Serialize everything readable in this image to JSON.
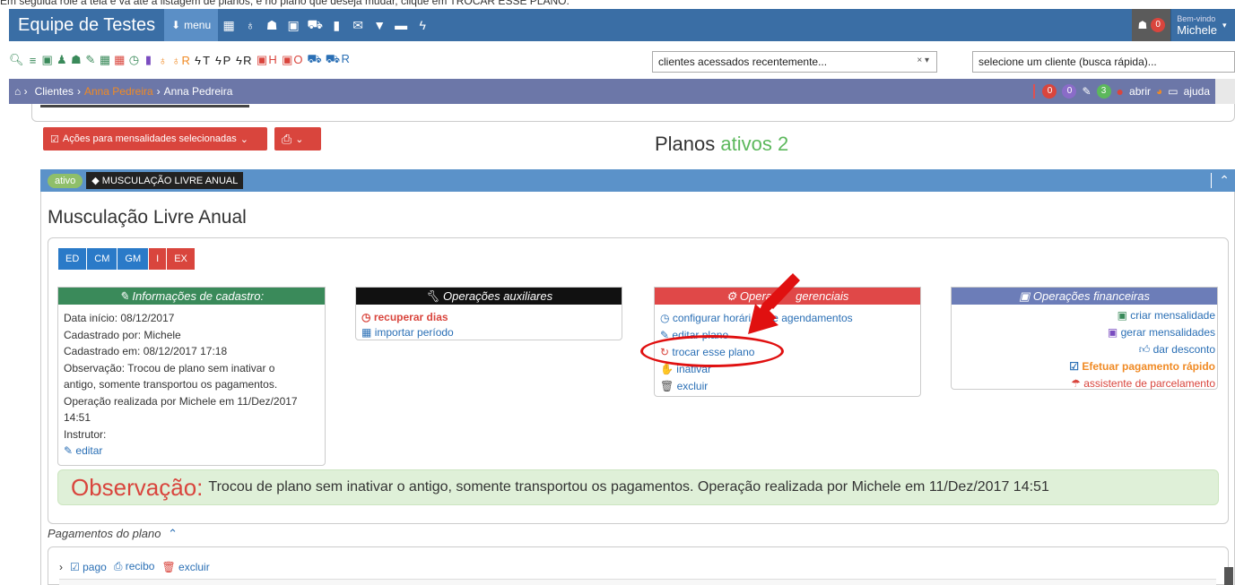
{
  "caption": "Em seguida role a tela e vá até a listagem de planos, e no plano que deseja mudar, clique em TROCAR ESSE PLANO.",
  "topbar": {
    "brand": "Equipe de Testes",
    "menu_label": "menu",
    "users_badge": "0",
    "welcome_small": "Bem-vindo",
    "welcome_name": "Michele"
  },
  "toolbar": {
    "icons_tail": [
      "R",
      "T",
      "P",
      "R",
      "H",
      "O",
      "R"
    ],
    "recent_clients": "clientes acessados recentemente...",
    "recent_clients_clear": "× ▾",
    "quick_search_placeholder": "selecione um cliente (busca rápida)..."
  },
  "breadcrumb": {
    "clientes": "Clientes",
    "link_name": "Anna Pedreira",
    "current": "Anna Pedreira",
    "badge1": "0",
    "badge2": "0",
    "badge3": "3",
    "abrir": "abrir",
    "ajuda": "ajuda"
  },
  "actions": {
    "mensalidades": "Ações para mensalidades selecionadas"
  },
  "planos": {
    "label": "Planos",
    "ativos_label": "ativos 2"
  },
  "plan": {
    "status": "ativo",
    "tag": "MUSCULAÇÃO LIVRE ANUAL",
    "name": "Musculação Livre Anual",
    "tags": [
      "ED",
      "CM",
      "GM",
      "I",
      "EX"
    ]
  },
  "cadastro": {
    "title": "Informações de cadastro:",
    "lines": [
      "Data início: 08/12/2017",
      "Cadastrado por: Michele",
      "Cadastrado em: 08/12/2017 17:18",
      "Observação: Trocou de plano sem inativar o",
      "antigo, somente transportou os pagamentos.",
      "Operação realizada por Michele em 11/Dez/2017",
      "14:51",
      "Instrutor:"
    ],
    "editar": "editar"
  },
  "auxiliares": {
    "title": "Operações auxiliares",
    "recuperar": "recuperar dias",
    "importar": "importar período"
  },
  "gerenciais": {
    "title_a": "Operaç",
    "title_b": "gerenciais",
    "configurar_a": "configurar horári",
    "configurar_b": "s de agendamentos",
    "editar_plano": "editar plano",
    "trocar": "trocar esse plano",
    "inativar": "inativar",
    "excluir": "excluir"
  },
  "financeiras": {
    "title": "Operações financeiras",
    "criar": "criar mensalidade",
    "gerar": "gerar mensalidades",
    "desconto": "dar desconto",
    "efetuar": "Efetuar pagamento rápido",
    "assistente": "assistente de parcelamento"
  },
  "observacao": {
    "label": "Observação:",
    "text": "Trocou de plano sem inativar o antigo, somente transportou os pagamentos. Operação realizada por Michele em 11/Dez/2017 14:51"
  },
  "pagamentos": {
    "title": "Pagamentos do plano",
    "pago": "pago",
    "recibo": "recibo",
    "excluir": "excluir"
  },
  "colors": {
    "topbar": "#3a6ea5",
    "green_header": "#3a8a5a",
    "black_header": "#111111",
    "red_header": "#d9453d",
    "blue_header": "#6c7db8",
    "annotation": "#e01010"
  }
}
